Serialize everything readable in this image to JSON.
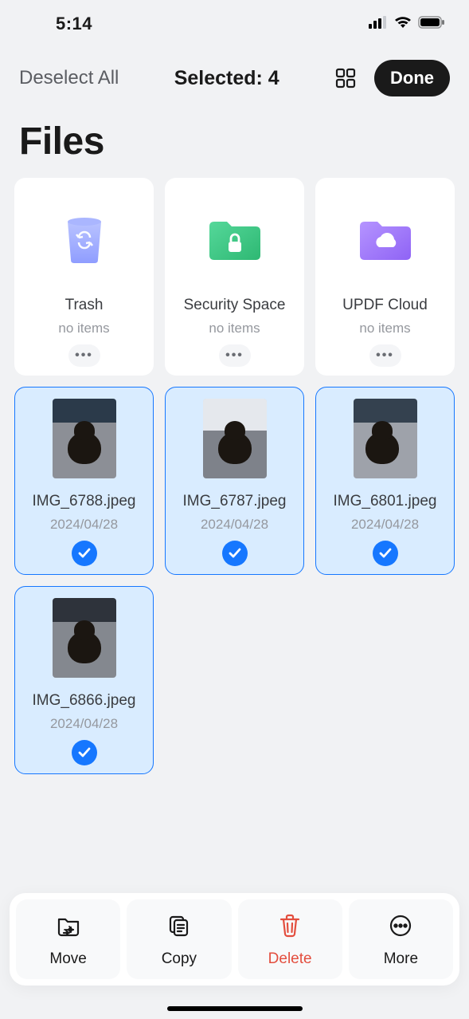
{
  "status": {
    "time": "5:14"
  },
  "topbar": {
    "deselect_label": "Deselect All",
    "selected_label": "Selected: 4",
    "done_label": "Done"
  },
  "page": {
    "title": "Files"
  },
  "folders": [
    {
      "name": "Trash",
      "meta": "no items",
      "icon": "trash",
      "color": "#9aa6ff"
    },
    {
      "name": "Security Space",
      "meta": "no items",
      "icon": "lock-folder",
      "color": "#3bc27b"
    },
    {
      "name": "UPDF Cloud",
      "meta": "no items",
      "icon": "cloud-folder",
      "color": "#9a6ff8"
    }
  ],
  "files": [
    {
      "name": "IMG_6788.jpeg",
      "date": "2024/04/28",
      "selected": true,
      "variant": "var1"
    },
    {
      "name": "IMG_6787.jpeg",
      "date": "2024/04/28",
      "selected": true,
      "variant": "var2"
    },
    {
      "name": "IMG_6801.jpeg",
      "date": "2024/04/28",
      "selected": true,
      "variant": "var3"
    },
    {
      "name": "IMG_6866.jpeg",
      "date": "2024/04/28",
      "selected": true,
      "variant": "var4"
    }
  ],
  "toolbar": {
    "move": "Move",
    "copy": "Copy",
    "delete": "Delete",
    "more": "More"
  }
}
